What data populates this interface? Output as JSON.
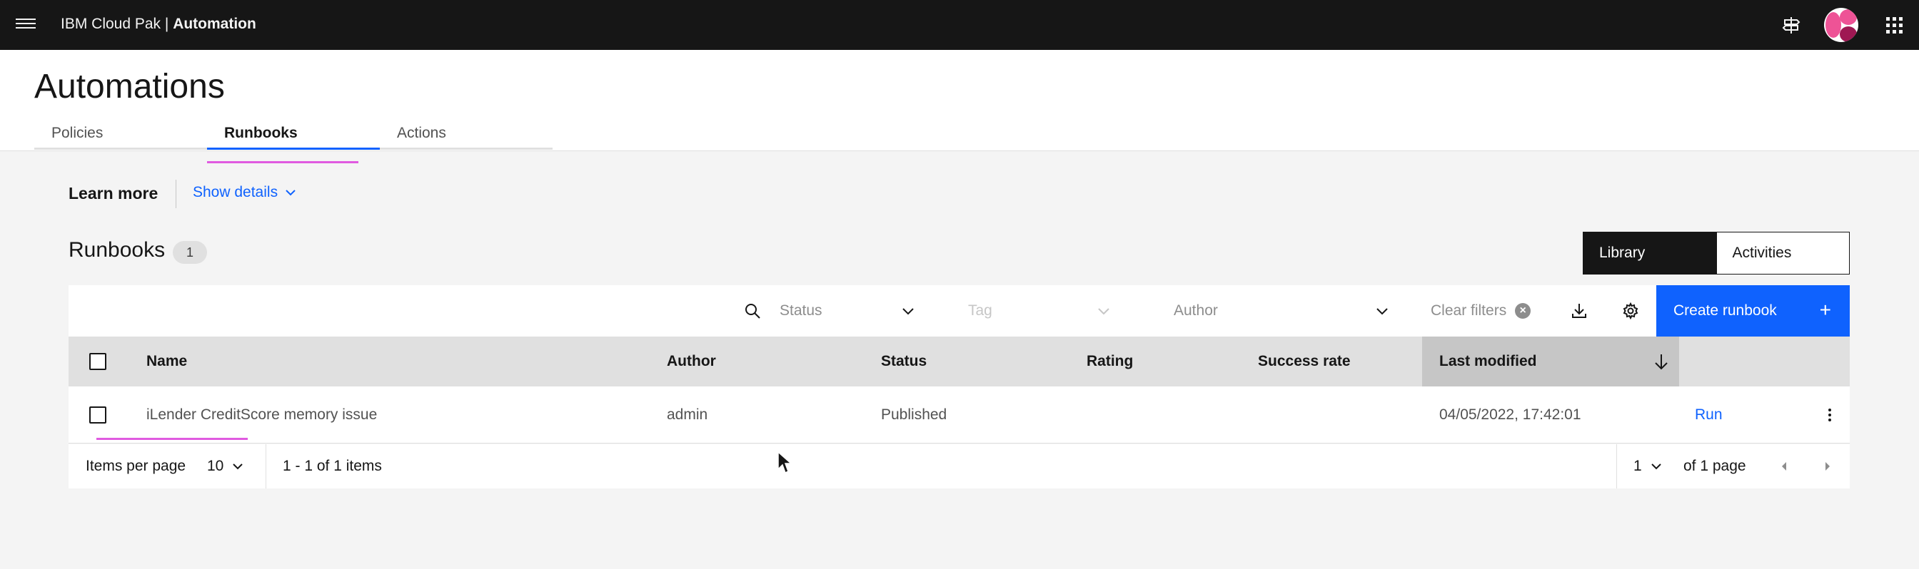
{
  "header": {
    "brand_prefix": "IBM Cloud Pak | ",
    "brand_product": "Automation"
  },
  "page": {
    "title": "Automations",
    "tabs": [
      {
        "label": "Policies",
        "active": false
      },
      {
        "label": "Runbooks",
        "active": true
      },
      {
        "label": "Actions",
        "active": false
      }
    ]
  },
  "learn_more": {
    "title": "Learn more",
    "show_details": "Show details"
  },
  "section": {
    "title": "Runbooks",
    "count": "1"
  },
  "view_switcher": {
    "library": "Library",
    "activities": "Activities",
    "selected": "Library"
  },
  "toolbar": {
    "status_placeholder": "Status",
    "tag_placeholder": "Tag",
    "author_placeholder": "Author",
    "clear_filters": "Clear filters",
    "create_button": "Create runbook",
    "create_icon": "+"
  },
  "table": {
    "columns": [
      "Name",
      "Author",
      "Status",
      "Rating",
      "Success rate",
      "Last modified"
    ],
    "sorted_column": "Last modified",
    "rows": [
      {
        "name": "iLender CreditScore memory issue",
        "author": "admin",
        "status": "Published",
        "rating": "",
        "success_rate": "",
        "last_modified": "04/05/2022, 17:42:01",
        "action": "Run"
      }
    ]
  },
  "pagination": {
    "items_per_page_label": "Items per page",
    "items_per_page": "10",
    "range_text": "1 - 1 of 1 items",
    "current_page": "1",
    "of_pages": "of 1 page"
  },
  "icons": {
    "menu": "hamburger-icon",
    "signpost": "signpost-icon",
    "avatar": "user-avatar",
    "app_switcher": "app-switcher-icon",
    "search": "search-icon",
    "download": "download-icon",
    "settings": "gear-icon"
  },
  "colors": {
    "header_bg": "#161616",
    "primary": "#0f62fe",
    "highlight": "#e05ae0"
  }
}
